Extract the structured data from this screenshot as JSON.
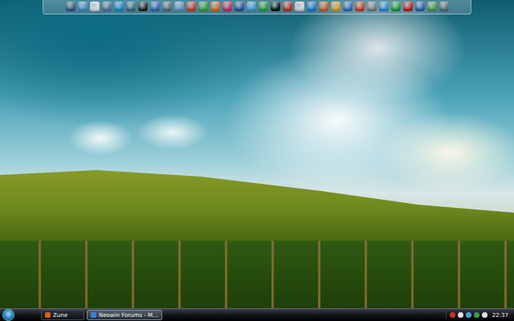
{
  "taskbar": {
    "items": [
      {
        "label": "Zune",
        "selected": false
      },
      {
        "label": "Neowin Forums - M...",
        "selected": true
      }
    ],
    "clock": "22:37"
  }
}
